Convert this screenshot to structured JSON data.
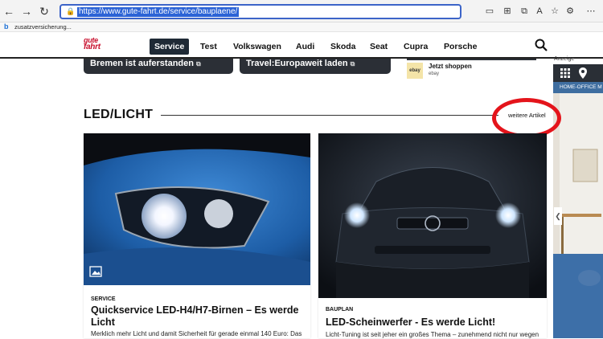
{
  "browser": {
    "url": "https://www.gute-fahrt.de/service/bauplaene/",
    "bookmark": "zusatzversicherung..."
  },
  "site": {
    "logo_line1": "gute",
    "logo_line2": "fahrt",
    "nav": [
      "Service",
      "Test",
      "Volkswagen",
      "Audi",
      "Skoda",
      "Seat",
      "Cupra",
      "Porsche"
    ]
  },
  "top_cards": [
    {
      "title": "Bremen ist auferstanden"
    },
    {
      "title": "Travel:Europaweit laden"
    }
  ],
  "ad_card": {
    "logo": "ebay",
    "title": "Jetzt shoppen",
    "source": "ebay"
  },
  "sidebar_ad": {
    "label": "Anzeige",
    "home": "HOME-OFFICE  M"
  },
  "section": {
    "title": "LED/LICHT",
    "more": "weitere Artikel"
  },
  "articles": [
    {
      "tag": "SERVICE",
      "title": "Quickservice LED-H4/H7-Birnen – Es werde Licht",
      "teaser": "Merklich mehr Licht und damit Sicherheit für gerade einmal 140 Euro: Das"
    },
    {
      "tag": "BAUPLAN",
      "title": "LED-Scheinwerfer - Es werde Licht!",
      "teaser": "Licht-Tuning ist seit jeher ein großes Thema – zunehmend nicht nur wegen"
    }
  ],
  "colors": {
    "accent": "#e4141b",
    "nav_active": "#1f2a36",
    "logo": "#c8102e"
  }
}
